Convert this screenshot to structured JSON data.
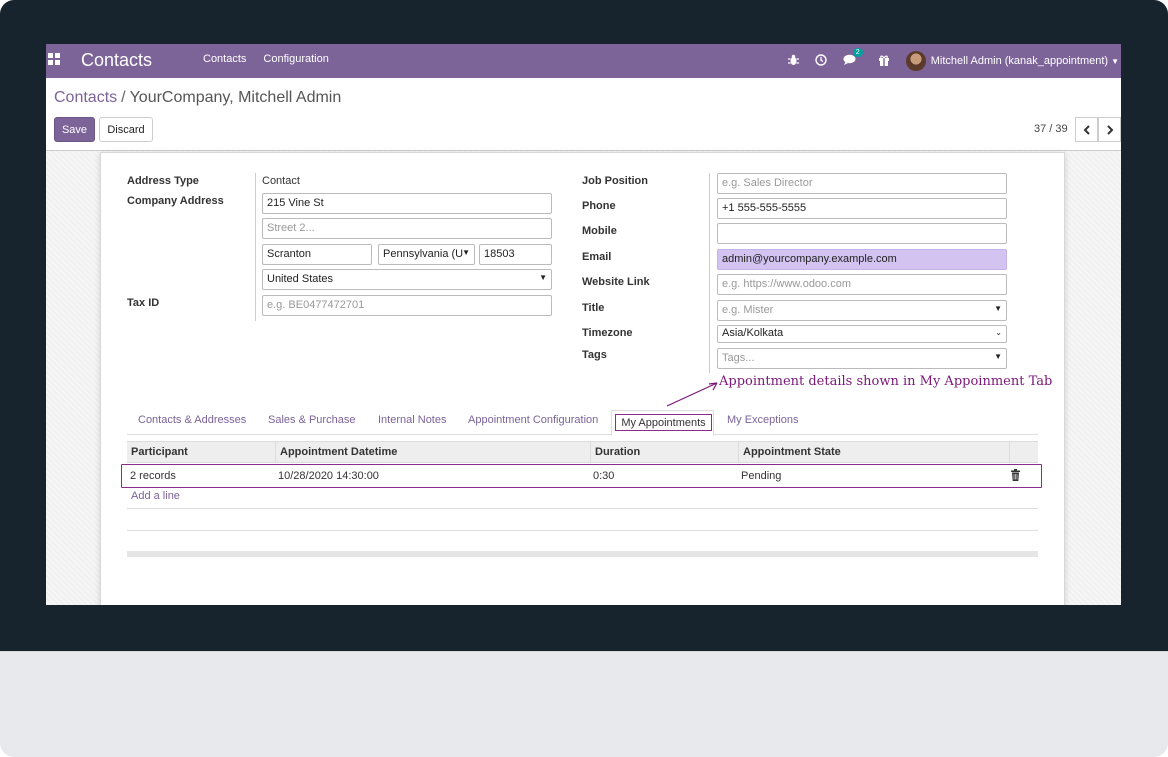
{
  "navbar": {
    "app_title": "Contacts",
    "menu": [
      "Contacts",
      "Configuration"
    ],
    "messages_badge": "2",
    "user": "Mitchell Admin (kanak_appointment)"
  },
  "breadcrumb": {
    "parent": "Contacts",
    "separator": "/",
    "current": "YourCompany, Mitchell Admin"
  },
  "buttons": {
    "save": "Save",
    "discard": "Discard"
  },
  "pager": {
    "text": "37 / 39"
  },
  "form": {
    "left": {
      "address_type_label": "Address Type",
      "address_type_value": "Contact",
      "company_address_label": "Company Address",
      "street": "215 Vine St",
      "street2_placeholder": "Street 2...",
      "city": "Scranton",
      "state": "Pennsylvania (U",
      "zip": "18503",
      "country": "United States",
      "tax_id_label": "Tax ID",
      "tax_id_placeholder": "e.g. BE0477472701"
    },
    "right": {
      "job_position_label": "Job Position",
      "job_position_placeholder": "e.g. Sales Director",
      "phone_label": "Phone",
      "phone_value": "+1 555-555-5555",
      "mobile_label": "Mobile",
      "mobile_value": "",
      "email_label": "Email",
      "email_value": "admin@yourcompany.example.com",
      "website_label": "Website Link",
      "website_placeholder": "e.g. https://www.odoo.com",
      "title_label": "Title",
      "title_placeholder": "e.g. Mister",
      "timezone_label": "Timezone",
      "timezone_value": "Asia/Kolkata",
      "tags_label": "Tags",
      "tags_placeholder": "Tags..."
    }
  },
  "annotation": "Appointment details shown in My Appoinment Tab",
  "tabs": [
    "Contacts & Addresses",
    "Sales & Purchase",
    "Internal Notes",
    "Appointment Configuration",
    "My Appointments",
    "My Exceptions"
  ],
  "table": {
    "columns": [
      "Participant",
      "Appointment Datetime",
      "Duration",
      "Appointment State"
    ],
    "rows": [
      {
        "participant": "2 records",
        "datetime": "10/28/2020 14:30:00",
        "duration": "0:30",
        "state": "Pending"
      }
    ],
    "add_line": "Add a line"
  },
  "colors": {
    "brand": "#7c6398",
    "annotation": "#7a1779",
    "email_highlight": "#d2c3f0"
  },
  "icons": [
    "apps-icon",
    "bug-icon",
    "clock-icon",
    "chat-icon",
    "gift-icon",
    "chevron-left-icon",
    "chevron-right-icon",
    "trash-icon",
    "caret-down-icon"
  ]
}
